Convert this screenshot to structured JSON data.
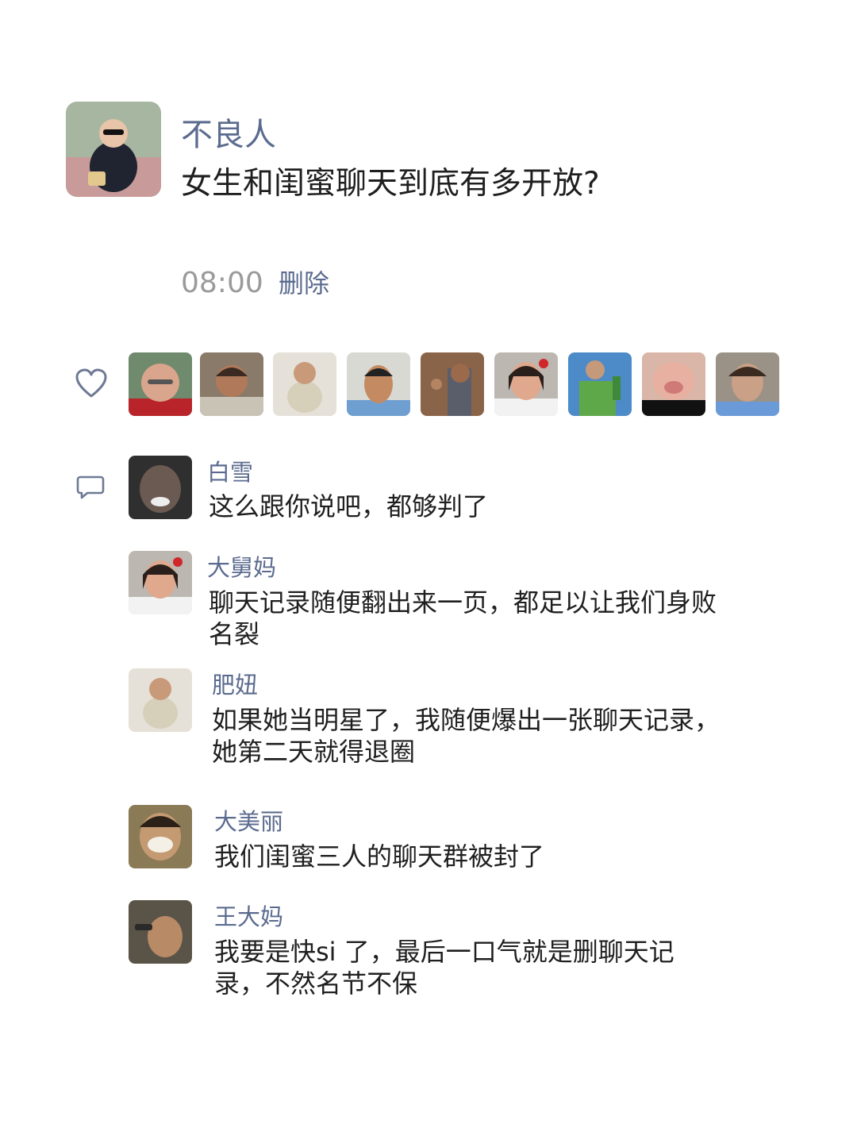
{
  "post": {
    "author": "不良人",
    "text": "女生和闺蜜聊天到底有多开放?",
    "time": "08:00",
    "delete_label": "删除"
  },
  "likes": {
    "icon": "heart-icon",
    "count_avatars": 9
  },
  "comments": [
    {
      "name": "白雪",
      "text": "这么跟你说吧，都够判了"
    },
    {
      "name": "大舅妈",
      "text": "聊天记录随便翻出来一页，都足以让我们身败名裂"
    },
    {
      "name": "肥妞",
      "text": "如果她当明星了，我随便爆出一张聊天记录，她第二天就得退圈"
    },
    {
      "name": "大美丽",
      "text": "我们闺蜜三人的聊天群被封了"
    },
    {
      "name": "王大妈",
      "text": "我要是快si 了，最后一口气就是删聊天记录，不然名节不保"
    }
  ],
  "colors": {
    "link": "#5b6b8f",
    "text": "#1f1f1f",
    "meta": "#9a9a9a",
    "icon": "#6e7a94"
  }
}
